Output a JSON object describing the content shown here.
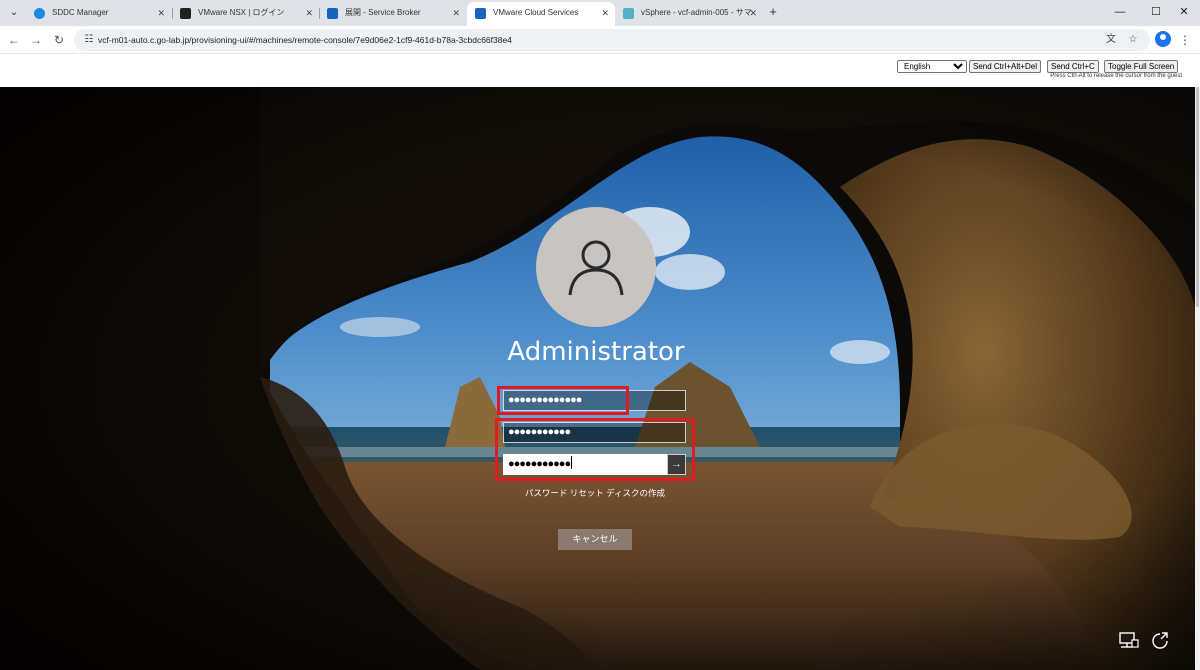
{
  "browser": {
    "tabs": [
      {
        "title": "SDDC Manager",
        "active": false,
        "favicon_color": "#1e88e5",
        "favicon": "cloud-icon"
      },
      {
        "title": "VMware NSX | ログイン",
        "active": false,
        "favicon_color": "#202020",
        "favicon": "nsx-icon"
      },
      {
        "title": "展開 - Service Broker",
        "active": false,
        "favicon_color": "#1565c0",
        "favicon": "vmware-icon"
      },
      {
        "title": "VMware Cloud Services",
        "active": true,
        "favicon_color": "#1565c0",
        "favicon": "vmware-icon"
      },
      {
        "title": "vSphere - vcf-admin-005 - サマ",
        "active": false,
        "favicon_color": "#4fb0c6",
        "favicon": "vsphere-icon"
      }
    ],
    "url": "vcf-m01-auto.c.go-lab.jp/provisioning-ui/#/machines/remote-console/7e9d06e2-1cf9-461d-b78a-3cbdc66f38e4"
  },
  "console_bar": {
    "keyboard_layout": "English",
    "send_ctrl_alt_del": "Send Ctrl+Alt+Del",
    "send_ctrl_c": "Send Ctrl+C",
    "toggle_full_screen": "Toggle Full Screen",
    "hint": "Press Ctrl-Alt to release the cursor from the guest"
  },
  "login": {
    "user_name": "Administrator",
    "current_password": "●●●●●●●●●●●●●",
    "new_password": "●●●●●●●●●●●",
    "confirm_password": "●●●●●●●●●●●",
    "reset_link": "パスワード リセット ディスクの作成",
    "cancel": "キャンセル",
    "highlight_color": "#e21b22"
  }
}
